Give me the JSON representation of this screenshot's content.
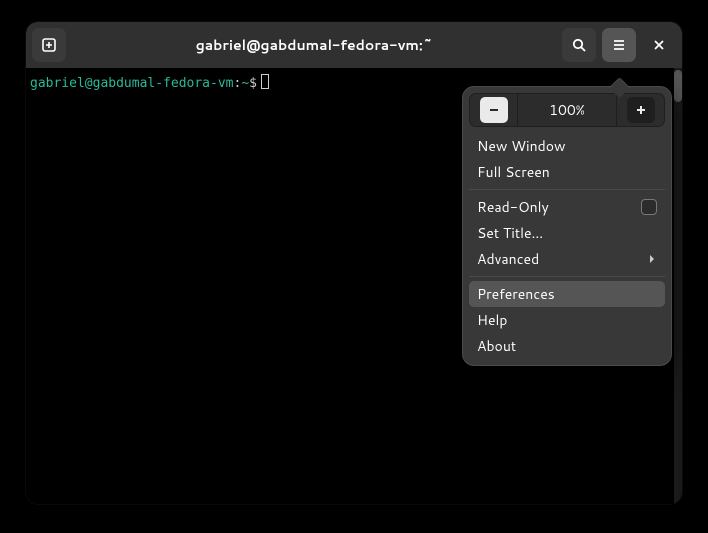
{
  "titlebar": {
    "title": "gabriel@gabdumal-fedora-vm:~"
  },
  "prompt": {
    "user_host": "gabriel@gabdumal-fedora-vm",
    "colon": ":",
    "cwd": "~",
    "sigil": "$"
  },
  "menu": {
    "zoom_level": "100%",
    "new_window": "New Window",
    "full_screen": "Full Screen",
    "read_only": "Read-Only",
    "set_title": "Set Title…",
    "advanced": "Advanced",
    "preferences": "Preferences",
    "help": "Help",
    "about": "About"
  },
  "icons": {
    "new_tab": "new-tab-icon",
    "search": "search-icon",
    "hamburger": "hamburger-icon",
    "close": "close-icon",
    "minus": "minus-icon",
    "plus": "plus-icon",
    "chevron_right": "chevron-right-icon"
  }
}
